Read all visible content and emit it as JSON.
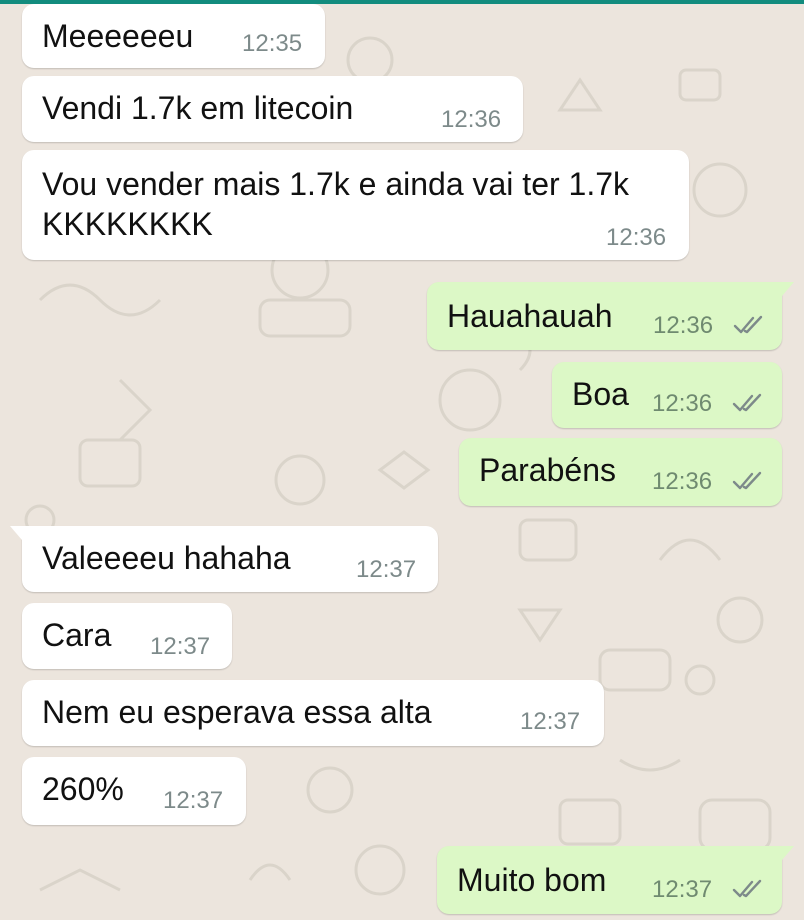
{
  "colors": {
    "wallpaper": "#ece5dd",
    "incoming_bubble": "#ffffff",
    "outgoing_bubble": "#dcf8c6",
    "timestamp": "#7d8a8a",
    "read_ticks": "#7d8a8a"
  },
  "icons": {
    "read_receipt": "double-check-icon"
  },
  "messages": [
    {
      "direction": "incoming",
      "text": "Meeeeeeu",
      "time": "12:35"
    },
    {
      "direction": "incoming",
      "text": "Vendi 1.7k em litecoin",
      "time": "12:36"
    },
    {
      "direction": "incoming",
      "text": "Vou vender mais 1.7k e ainda vai ter 1.7k KKKKKKKK",
      "time": "12:36"
    },
    {
      "direction": "outgoing",
      "text": "Hauahauah",
      "time": "12:36",
      "status": "read"
    },
    {
      "direction": "outgoing",
      "text": "Boa",
      "time": "12:36",
      "status": "read"
    },
    {
      "direction": "outgoing",
      "text": "Parabéns",
      "time": "12:36",
      "status": "read"
    },
    {
      "direction": "incoming",
      "text": "Valeeeeu hahaha",
      "time": "12:37"
    },
    {
      "direction": "incoming",
      "text": "Cara",
      "time": "12:37"
    },
    {
      "direction": "incoming",
      "text": "Nem eu esperava essa alta",
      "time": "12:37"
    },
    {
      "direction": "incoming",
      "text": "260%",
      "time": "12:37"
    },
    {
      "direction": "outgoing",
      "text": "Muito bom",
      "time": "12:37",
      "status": "read"
    }
  ]
}
